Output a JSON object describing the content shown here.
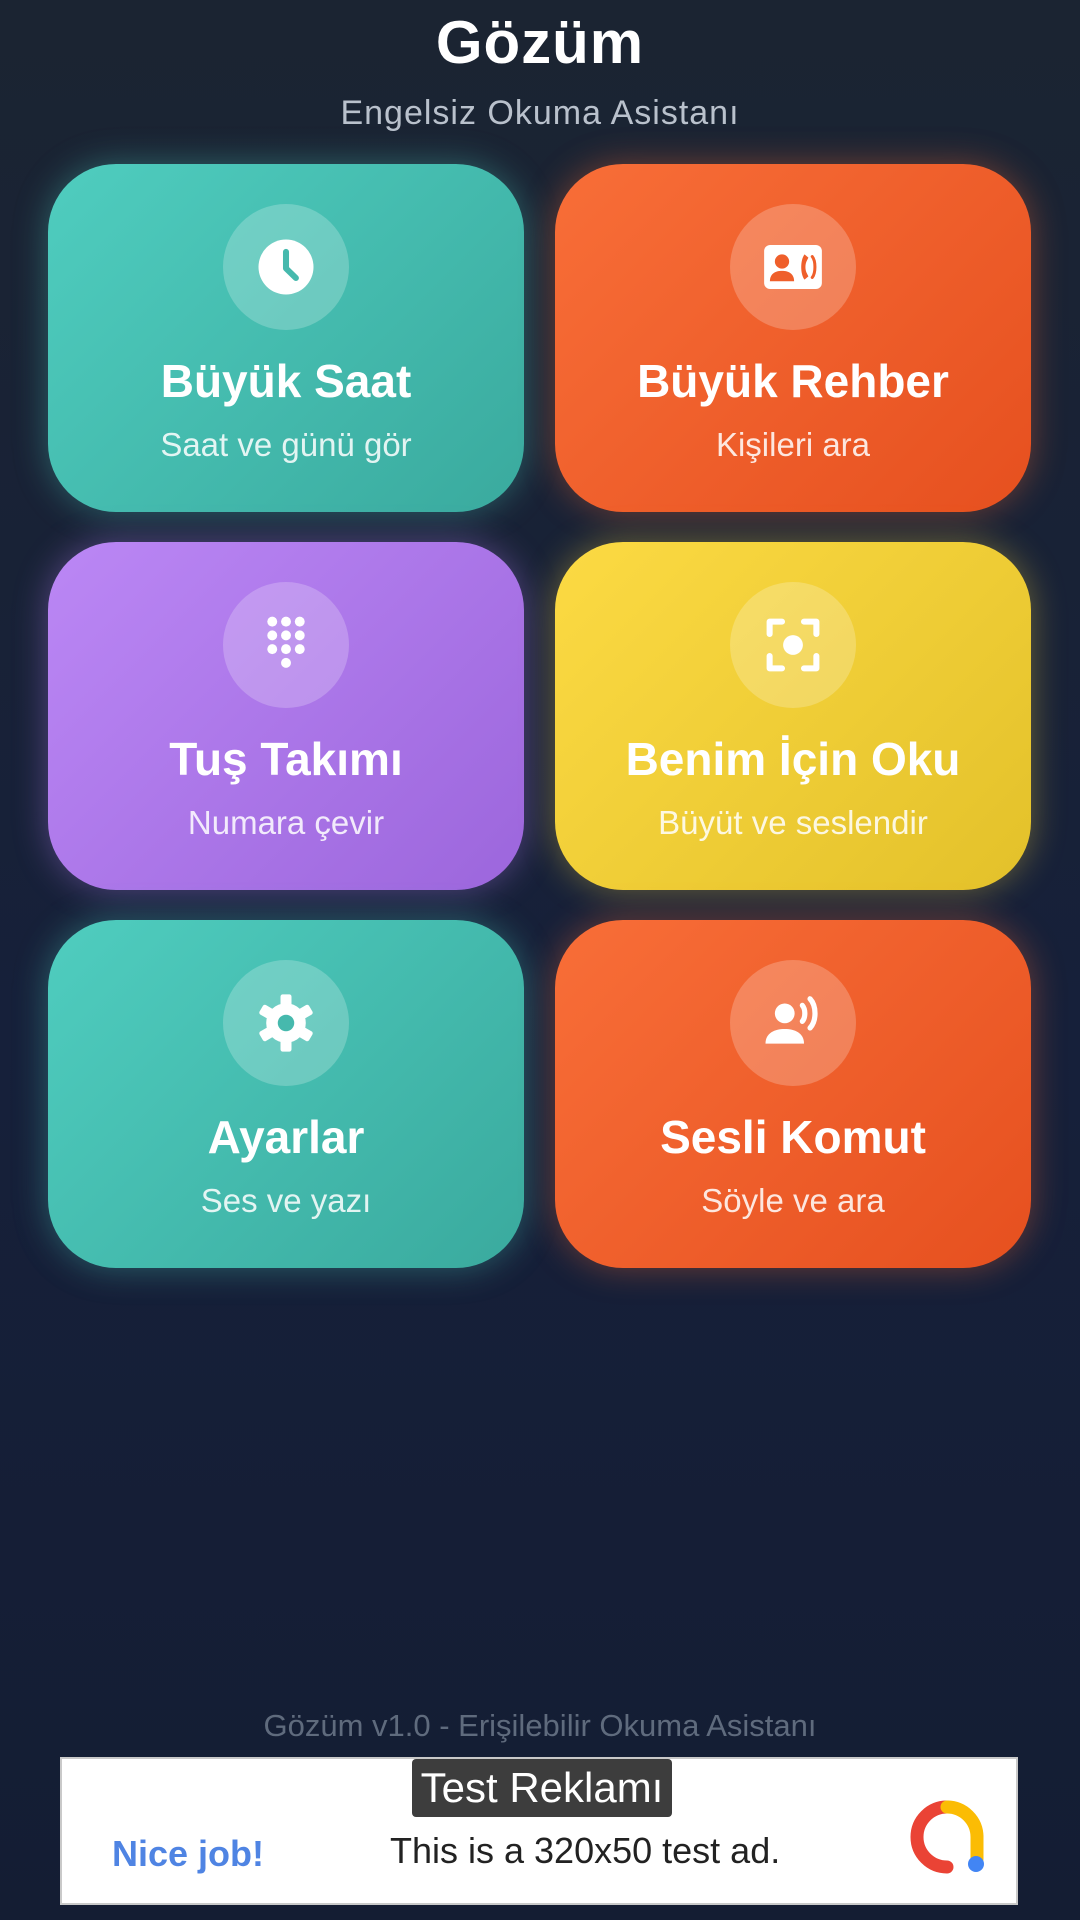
{
  "header": {
    "title": "Gözüm",
    "subtitle": "Engelsiz Okuma Asistanı"
  },
  "tiles": [
    {
      "title": "Büyük Saat",
      "subtitle": "Saat ve günü gör",
      "icon": "clock-icon",
      "color": "#4fcdbf"
    },
    {
      "title": "Büyük Rehber",
      "subtitle": "Kişileri ara",
      "icon": "contact-phone-icon",
      "color": "#f86e38"
    },
    {
      "title": "Tuş Takımı",
      "subtitle": "Numara çevir",
      "icon": "dialpad-icon",
      "color": "#bb87f5"
    },
    {
      "title": "Benim İçin Oku",
      "subtitle": "Büyüt ve seslendir",
      "icon": "scan-focus-icon",
      "color": "#fcda43"
    },
    {
      "title": "Ayarlar",
      "subtitle": "Ses ve yazı",
      "icon": "gear-icon",
      "color": "#4fcdbf"
    },
    {
      "title": "Sesli Komut",
      "subtitle": "Söyle ve ara",
      "icon": "voice-person-icon",
      "color": "#f86e38"
    }
  ],
  "footer": {
    "text": "Gözüm v1.0 - Erişilebilir Okuma Asistanı"
  },
  "ad": {
    "badge": "Test Reklamı",
    "headline": "Nice job!",
    "text": "This is a 320x50 test ad.",
    "icon": "admob-logo-icon"
  }
}
